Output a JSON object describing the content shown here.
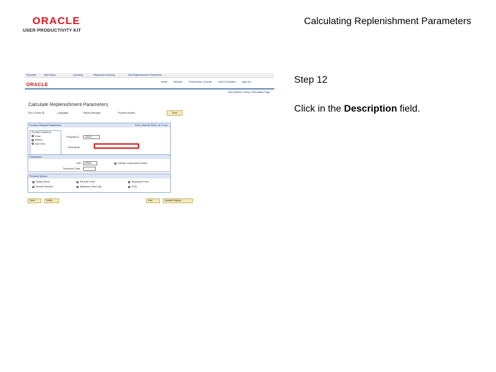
{
  "logo": {
    "brand": "ORACLE",
    "product": "USER PRODUCTIVITY KIT"
  },
  "doc_title": "Calculating Replenishment Parameters",
  "step": {
    "number_label": "Step 12",
    "instruction_prefix": "Click in the ",
    "instruction_target": "Description",
    "instruction_suffix": " field."
  },
  "screenshot": {
    "topnav": [
      "Favorites",
      "Main Menu",
      "Inventory",
      "Replenish Inventory",
      "Set Replenishment Parameters"
    ],
    "brand": "ORACLE",
    "header_links": [
      "Home",
      "Worklist",
      "Performance Console",
      "Add to Favorites",
      "Sign out"
    ],
    "new_window": "New Window | Help | Personalize Page",
    "page_title": "Calculate Replenishment Parameters",
    "header_fields": [
      "Run Control ID:",
      "Language:",
      "Report Manager",
      "Process Monitor"
    ],
    "run_button": "Run",
    "box1_title": "Process Request Parameters",
    "box1_nav": "Find | View All   First  1 of 1  Last",
    "frequency_title": "Process Frequency",
    "frequency_options": [
      "Once",
      "Always",
      "Don't Run"
    ],
    "request_id_label": "*Request ID",
    "request_id_value": "LS001",
    "description_label": "Description",
    "box2_title": "Parameters",
    "unit_label": "Unit",
    "unit_value": "US001",
    "include_label": "Include Consumption Items",
    "threshold_label": "Threshold Class",
    "box3_title": "Process Options",
    "options": [
      "Safety Stock",
      "Annual Demand",
      "Reorder Point",
      "Maximum Stock Qty",
      "Replenish Point",
      "EOQ"
    ],
    "bottom_buttons": [
      "Save",
      "Notify",
      "Add",
      "Update/Display"
    ]
  }
}
